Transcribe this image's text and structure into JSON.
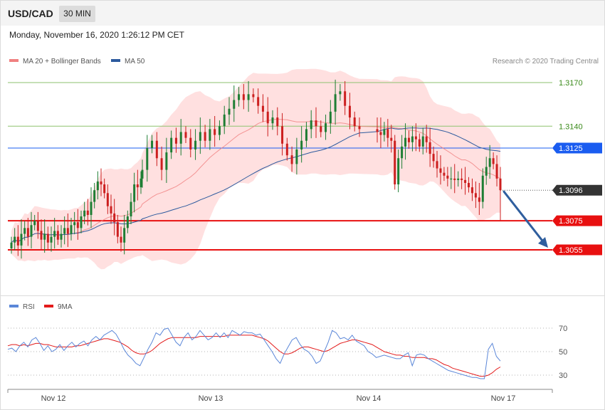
{
  "header": {
    "symbol": "USD/CAD",
    "timeframe": "30 MIN"
  },
  "date": "Monday, November 16, 2020 1:26:12 PM CET",
  "legend": [
    {
      "label": "MA 20 + Bollinger Bands",
      "color": "#f08080"
    },
    {
      "label": "MA 50",
      "color": "#2c5a9e"
    }
  ],
  "credit": "Research © 2020 Trading Central",
  "rsi_legend": [
    {
      "label": "RSI",
      "color": "#5b87d8"
    },
    {
      "label": "9MA",
      "color": "#e31b1b"
    }
  ],
  "colors": {
    "up": "#1e7e34",
    "down": "#cc1f1f",
    "band": "#ffd6d6",
    "ma20": "#f08080",
    "ma50": "#2c5a9e",
    "rsi": "#5b87d8",
    "rsi_ma": "#e31b1b",
    "resistance": "#8dc26f",
    "pivot": "#1a5cf0",
    "support": "#e81010",
    "last": "#333333",
    "arrow": "#2f5e9e"
  },
  "chart_data": [
    {
      "type": "candlestick",
      "title": "USD/CAD 30 MIN",
      "ylim": [
        1.303,
        1.319
      ],
      "x_ticks": [
        "Nov 12",
        "Nov 13",
        "Nov 14",
        "Nov 17"
      ],
      "levels": [
        {
          "label": "1.3170",
          "value": 1.317,
          "kind": "resistance"
        },
        {
          "label": "1.3140",
          "value": 1.314,
          "kind": "resistance"
        },
        {
          "label": "1.3125",
          "value": 1.3125,
          "kind": "pivot"
        },
        {
          "label": "1.3096",
          "value": 1.3096,
          "kind": "last"
        },
        {
          "label": "1.3075",
          "value": 1.3075,
          "kind": "support"
        },
        {
          "label": "1.3055",
          "value": 1.3055,
          "kind": "support"
        }
      ],
      "forecast": {
        "from": 1.3096,
        "to": 1.3055
      },
      "segments": [
        {
          "label": "Nov 12",
          "closes": [
            1.306,
            1.3064,
            1.3058,
            1.3066,
            1.307,
            1.3064,
            1.3072,
            1.3075,
            1.3068,
            1.3062,
            1.3066,
            1.306,
            1.3064,
            1.3068,
            1.3062,
            1.3066,
            1.307,
            1.3066,
            1.3072,
            1.3074,
            1.307,
            1.3078,
            1.3082,
            1.3079,
            1.3088,
            1.3096,
            1.3102,
            1.31,
            1.3094,
            1.3085,
            1.308,
            1.3074,
            1.3064,
            1.306,
            1.307,
            1.3078,
            1.3088,
            1.31,
            1.3098,
            1.3104
          ]
        },
        {
          "label": "Nov 13",
          "closes": [
            1.311,
            1.3125,
            1.313,
            1.3118,
            1.311,
            1.3122,
            1.3132,
            1.3128,
            1.3136,
            1.3132,
            1.3124,
            1.313,
            1.3136,
            1.313,
            1.3138,
            1.3134,
            1.314,
            1.3148,
            1.3152,
            1.3158,
            1.3162,
            1.3158,
            1.3162,
            1.316,
            1.3154,
            1.315,
            1.3142,
            1.3146,
            1.314,
            1.3128,
            1.312,
            1.3114,
            1.3124,
            1.313,
            1.3138,
            1.3144,
            1.314,
            1.3136,
            1.3142,
            1.315,
            1.3162,
            1.3164,
            1.3154,
            1.3146,
            1.314,
            1.3138
          ]
        },
        {
          "label": "Nov 14",
          "closes": [
            1.3136,
            1.3134,
            1.3138,
            1.3132,
            1.313,
            1.31,
            1.3118,
            1.3126,
            1.3132,
            1.3129,
            1.3133,
            1.3131,
            1.3126,
            1.3133,
            1.3129,
            1.3121,
            1.3116,
            1.3111,
            1.3108,
            1.3106,
            1.3104,
            1.3104,
            1.3103,
            1.3104,
            1.3103,
            1.3101,
            1.3098,
            1.3094,
            1.3091,
            1.3088,
            1.3106,
            1.3112,
            1.3118,
            1.3114,
            1.3104,
            1.3096
          ]
        }
      ]
    },
    {
      "type": "line",
      "title": "RSI",
      "ylim": [
        15,
        85
      ],
      "y_ticks": [
        "70",
        "50",
        "30"
      ],
      "series": [
        {
          "name": "RSI",
          "values": [
            52,
            53,
            50,
            55,
            58,
            54,
            60,
            62,
            57,
            51,
            55,
            50,
            52,
            56,
            51,
            55,
            58,
            54,
            57,
            59,
            55,
            60,
            63,
            60,
            64,
            66,
            68,
            65,
            59,
            52,
            47,
            44,
            40,
            38,
            45,
            52,
            58,
            66,
            64,
            69,
            70,
            64,
            58,
            55,
            62,
            66,
            60,
            63,
            68,
            64,
            60,
            62,
            66,
            62,
            66,
            62,
            68,
            66,
            64,
            67,
            66,
            66,
            64,
            65,
            60,
            55,
            50,
            44,
            40,
            48,
            54,
            60,
            62,
            56,
            52,
            50,
            46,
            40,
            42,
            50,
            58,
            68,
            66,
            61,
            62,
            60,
            64,
            59,
            57,
            55,
            50,
            48,
            45,
            46,
            47,
            46,
            45,
            44,
            44,
            47,
            49,
            38,
            47,
            48,
            47,
            44,
            42,
            40,
            38,
            36,
            34,
            33,
            32,
            31,
            30,
            29,
            28,
            28,
            27,
            27,
            52,
            57,
            46,
            42
          ]
        },
        {
          "name": "9MA",
          "values": [
            55,
            56,
            56,
            55,
            56,
            55,
            56,
            57,
            57,
            56,
            56,
            55,
            54,
            54,
            54,
            54,
            54,
            55,
            55,
            56,
            57,
            58,
            59,
            60,
            61,
            61,
            60,
            59,
            58,
            56,
            54,
            51,
            49,
            48,
            48,
            49,
            51,
            54,
            57,
            59,
            61,
            62,
            62,
            62,
            62,
            62,
            62,
            62,
            63,
            63,
            63,
            63,
            63,
            63,
            63,
            64,
            64,
            64,
            64,
            64,
            64,
            64,
            63,
            62,
            61,
            59,
            56,
            53,
            50,
            48,
            48,
            49,
            51,
            53,
            54,
            54,
            53,
            52,
            51,
            50,
            51,
            53,
            55,
            57,
            58,
            59,
            60,
            60,
            59,
            58,
            57,
            56,
            54,
            52,
            50,
            49,
            48,
            47,
            47,
            46,
            46,
            45,
            45,
            45,
            45,
            44,
            44,
            43,
            41,
            39,
            38,
            36,
            35,
            34,
            33,
            32,
            31,
            30,
            29,
            29,
            30,
            32,
            35,
            37
          ]
        }
      ]
    }
  ]
}
